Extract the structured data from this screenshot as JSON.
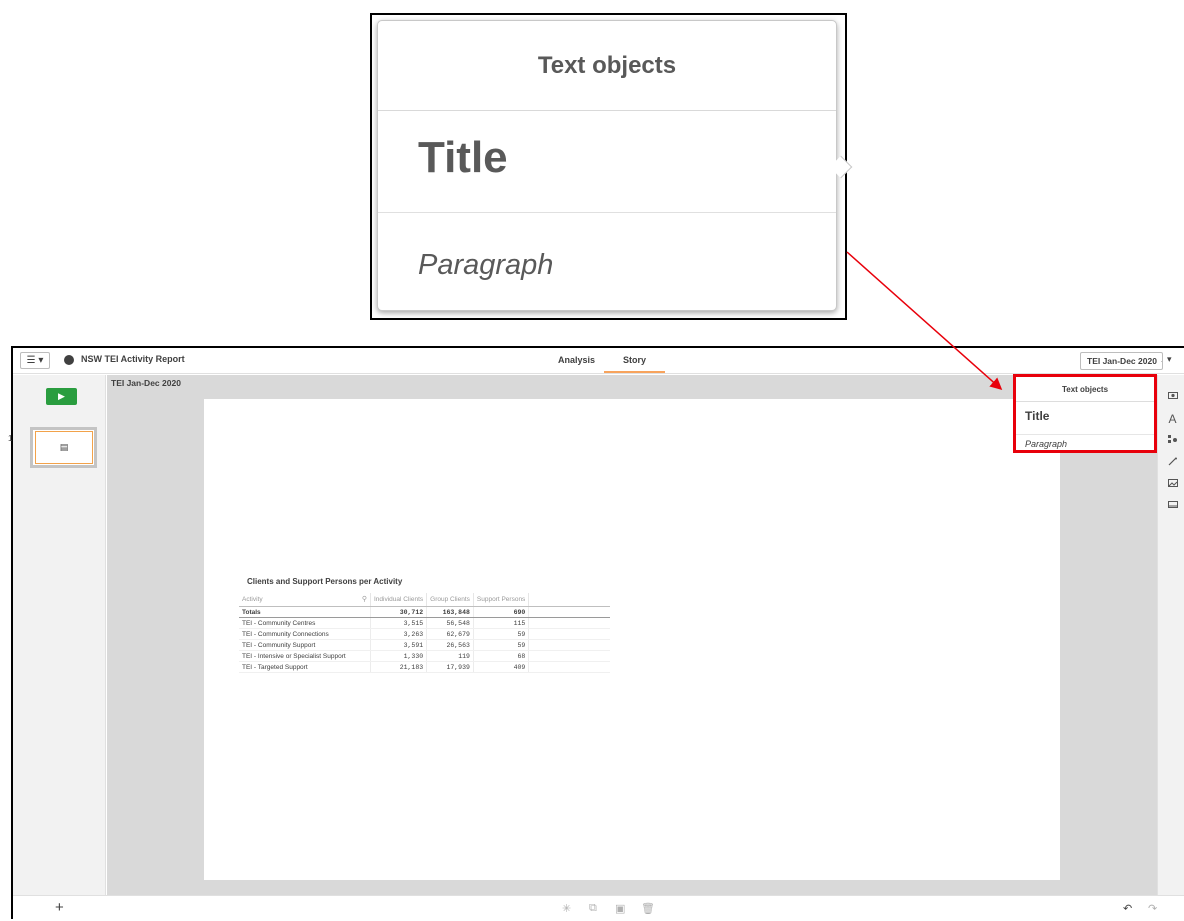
{
  "callout": {
    "header": "Text objects",
    "title": "Title",
    "paragraph": "Paragraph"
  },
  "topbar": {
    "menu_icon": "☰ ▾",
    "app_title": "NSW TEI Activity Report",
    "tabs": [
      {
        "label": "Analysis"
      },
      {
        "label": "Story"
      }
    ],
    "story_name": "TEI Jan-Dec 2020",
    "story_caret": "▾"
  },
  "left_panel": {
    "play_icon": "▶",
    "slide_number": "1",
    "thumb_glyph": "▤",
    "add_icon": "+"
  },
  "canvas": {
    "story_title": "TEI Jan-Dec 2020"
  },
  "table": {
    "title": "Clients and Support Persons per Activity",
    "headers": [
      "Activity",
      "Individual Clients",
      "Group Clients",
      "Support Persons"
    ],
    "totals": [
      "Totals",
      "30,712",
      "163,848",
      "690"
    ],
    "rows": [
      [
        "TEI - Community Centres",
        "3,515",
        "56,548",
        "115"
      ],
      [
        "TEI - Community Connections",
        "3,263",
        "62,679",
        "59"
      ],
      [
        "TEI - Community Support",
        "3,591",
        "26,563",
        "59"
      ],
      [
        "TEI - Intensive or Specialist Support",
        "1,330",
        "119",
        "68"
      ],
      [
        "TEI - Targeted Support",
        "21,183",
        "17,939",
        "409"
      ]
    ]
  },
  "text_objects_panel": {
    "header": "Text objects",
    "title": "Title",
    "paragraph": "Paragraph"
  },
  "right_toolbar": {
    "icons": [
      "camera-icon",
      "text-icon",
      "shapes-icon",
      "effects-icon",
      "image-icon",
      "media-icon"
    ]
  },
  "bottom_toolbar": {
    "icons": [
      "pin-icon",
      "copy-icon",
      "paste-icon",
      "delete-icon"
    ],
    "undo_icon": "↶",
    "redo_icon": "↷"
  },
  "colors": {
    "highlight_red": "#e8000b",
    "play_green": "#2a9d3f",
    "tab_accent": "#f7a35c"
  }
}
